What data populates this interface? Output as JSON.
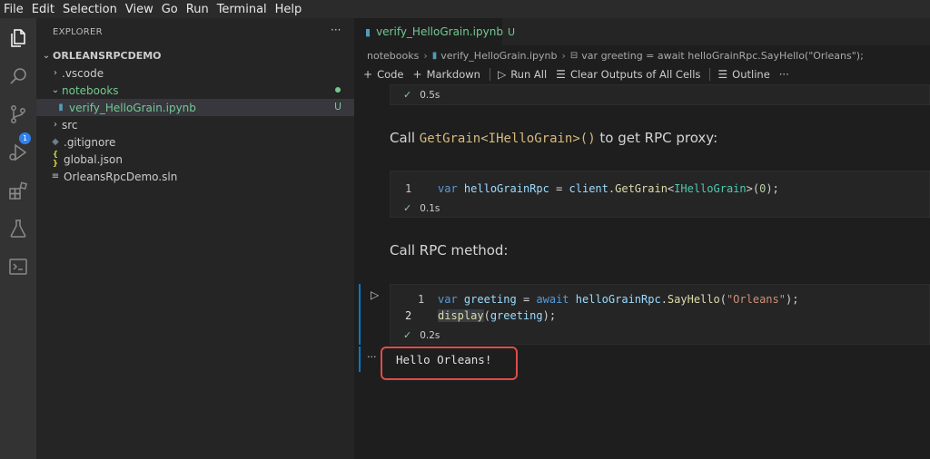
{
  "menu": [
    "File",
    "Edit",
    "Selection",
    "View",
    "Go",
    "Run",
    "Terminal",
    "Help"
  ],
  "activity": {
    "scm_badge": "1"
  },
  "explorer": {
    "title": "EXPLORER",
    "more": "···",
    "root": "ORLEANSRPCDEMO",
    "items": [
      {
        "label": ".vscode"
      },
      {
        "label": "notebooks"
      },
      {
        "label": "verify_HelloGrain.ipynb",
        "status": "U"
      },
      {
        "label": "src"
      },
      {
        "label": ".gitignore"
      },
      {
        "label": "global.json"
      },
      {
        "label": "OrleansRpcDemo.sln"
      }
    ],
    "json_icon": "{ }"
  },
  "tab": {
    "label": "verify_HelloGrain.ipynb",
    "status": "U"
  },
  "breadcrumb": {
    "folder": "notebooks",
    "file": "verify_HelloGrain.ipynb",
    "symbol": "var greeting = await helloGrainRpc.SayHello(\"Orleans\");"
  },
  "toolbar": {
    "code": "Code",
    "markdown": "Markdown",
    "run_all": "Run All",
    "clear": "Clear Outputs of All Cells",
    "outline": "Outline",
    "more": "···"
  },
  "cells": {
    "cell0_time": "0.5s",
    "md1_prefix": "Call ",
    "md1_code": "GetGrain<IHelloGrain>()",
    "md1_suffix": " to get RPC proxy:",
    "code1": {
      "line_no": "1",
      "tok_var": "var",
      "tok_name": "helloGrainRpc",
      "tok_eq": " = ",
      "tok_client": "client",
      "tok_dot": ".",
      "tok_fn": "GetGrain",
      "tok_lt": "<",
      "tok_type": "IHelloGrain",
      "tok_gt": ">(",
      "tok_num": "0",
      "tok_end": ");",
      "time": "0.1s"
    },
    "md2": "Call RPC method:",
    "code2": {
      "line1_no": "1",
      "line2_no": "2",
      "l1_var": "var",
      "l1_name": "greeting",
      "l1_eq": " = ",
      "l1_await": "await",
      "l1_obj": "helloGrainRpc",
      "l1_dot": ".",
      "l1_fn": "SayHello",
      "l1_open": "(",
      "l1_str": "\"Orleans\"",
      "l1_close": ");",
      "l2_fn": "display",
      "l2_open": "(",
      "l2_arg": "greeting",
      "l2_close": ");",
      "time": "0.2s"
    },
    "output_dots": "···",
    "output": "Hello Orleans!"
  }
}
